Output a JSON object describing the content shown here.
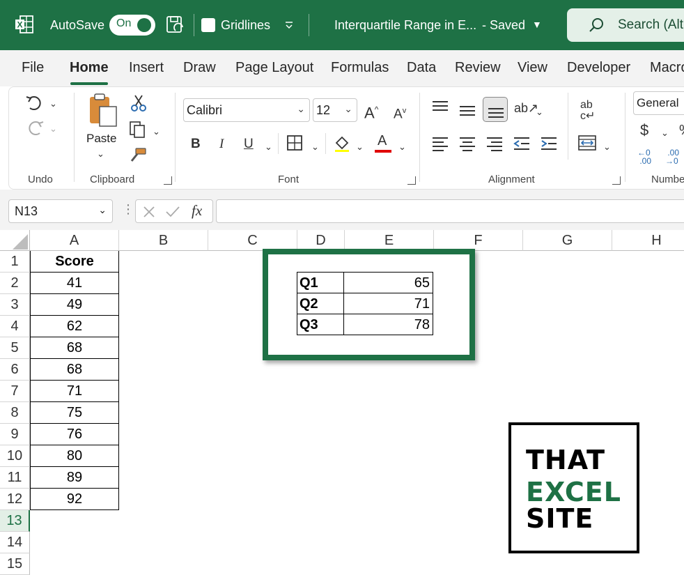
{
  "titlebar": {
    "autosave_label": "AutoSave",
    "autosave_state": "On",
    "gridlines_label": "Gridlines",
    "file_title": "Interquartile Range in E...",
    "saved_label": "-  Saved",
    "search_label": "Search (Alt"
  },
  "tabs": [
    "File",
    "Home",
    "Insert",
    "Draw",
    "Page Layout",
    "Formulas",
    "Data",
    "Review",
    "View",
    "Developer",
    "Macro"
  ],
  "ribbon": {
    "undo_label": "Undo",
    "clipboard_label": "Clipboard",
    "paste_label": "Paste",
    "font_label": "Font",
    "font_name": "Calibri",
    "font_size": "12",
    "bold": "B",
    "italic": "I",
    "underline": "U",
    "alignment_label": "Alignment",
    "number_format": "General",
    "number_label": "Numbe",
    "currency": "$"
  },
  "formula_bar": {
    "name_box": "N13",
    "fx": "fx",
    "value": ""
  },
  "columns": [
    "A",
    "B",
    "C",
    "D",
    "E",
    "F",
    "G",
    "H"
  ],
  "rows": [
    "1",
    "2",
    "3",
    "4",
    "5",
    "6",
    "7",
    "8",
    "9",
    "10",
    "11",
    "12",
    "13",
    "14",
    "15"
  ],
  "selected_row": "13",
  "score_header": "Score",
  "scores": [
    "41",
    "49",
    "62",
    "68",
    "68",
    "71",
    "75",
    "76",
    "80",
    "89",
    "92"
  ],
  "quartiles": [
    {
      "label": "Q1",
      "value": "65"
    },
    {
      "label": "Q2",
      "value": "71"
    },
    {
      "label": "Q3",
      "value": "78"
    }
  ],
  "logo": {
    "line1": "THAT",
    "line2": "EXCEL",
    "line3": "SITE",
    "accent_color": "#1e7145"
  },
  "colors": {
    "excel_green": "#1e7145"
  }
}
